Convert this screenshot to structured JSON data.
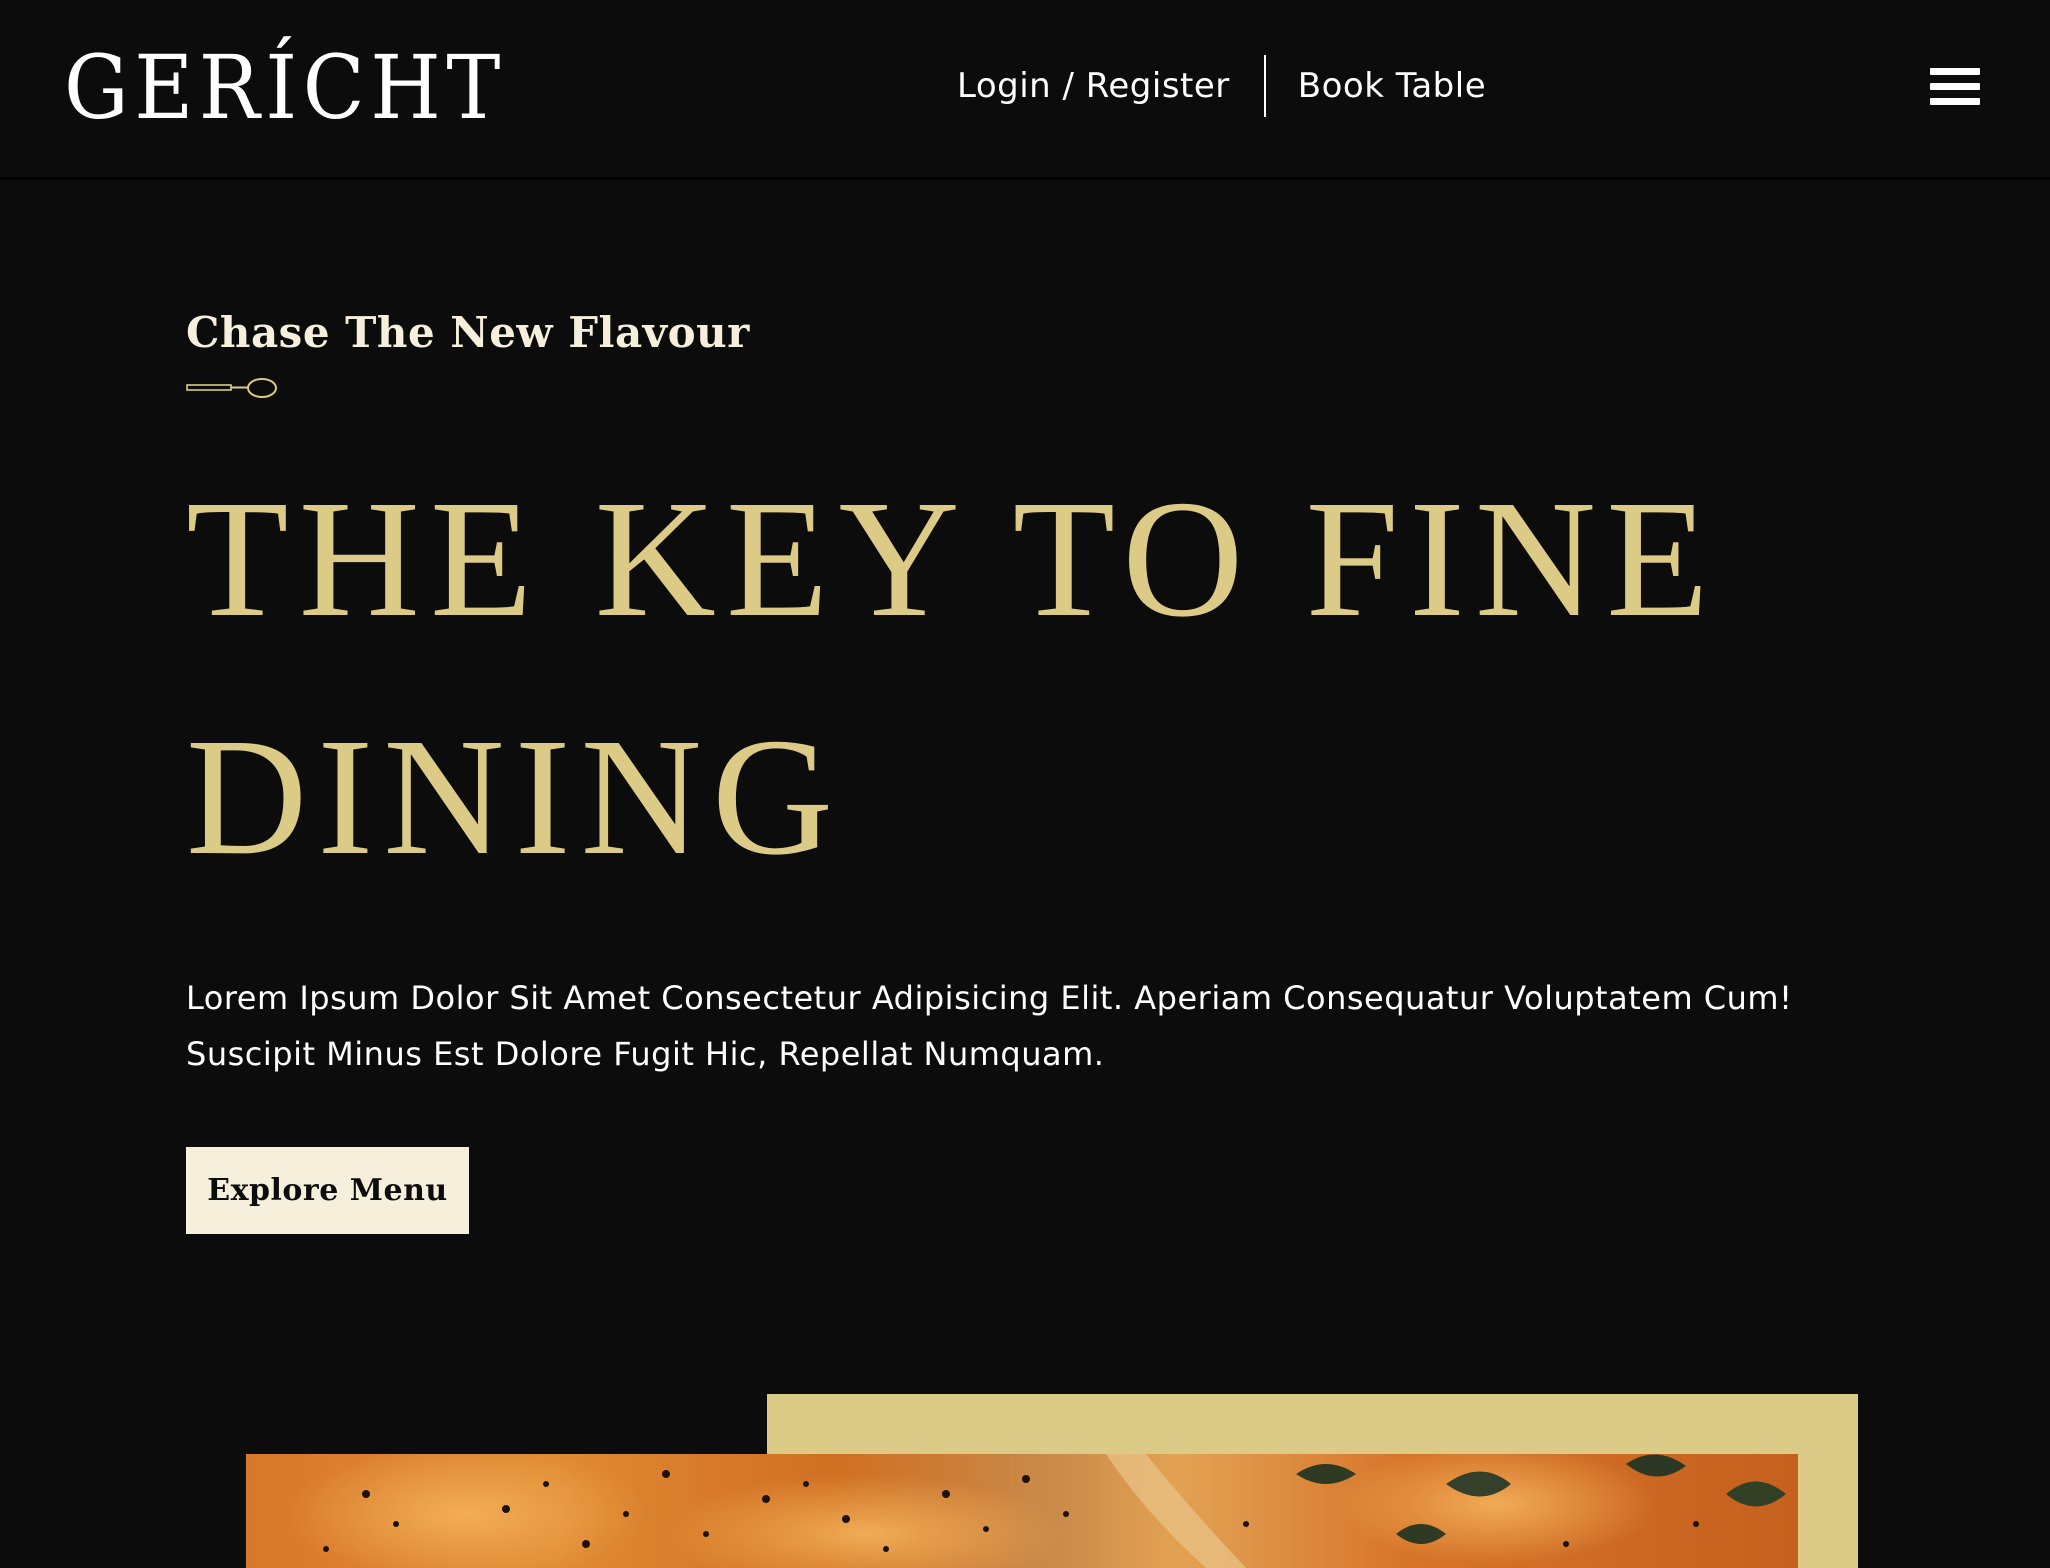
{
  "navbar": {
    "logo": "GERÍCHT",
    "links": {
      "login": "Login / Register",
      "book": "Book Table"
    },
    "menu_icon": "hamburger-menu-icon"
  },
  "hero": {
    "subtitle": "Chase The New Flavour",
    "divider_icon": "spoon-icon",
    "headline": "THE KEY TO FINE DINING",
    "description": "Lorem Ipsum Dolor Sit Amet Consectetur Adipisicing Elit. Aperiam Consequatur Voluptatem Cum! Suscipit Minus Est Dolore Fugit Hic, Repellat Numquam.",
    "cta_label": "Explore Menu"
  },
  "colors": {
    "background": "#0c0c0c",
    "gold": "#dcca87",
    "cream": "#f5efdb",
    "white": "#ffffff"
  }
}
